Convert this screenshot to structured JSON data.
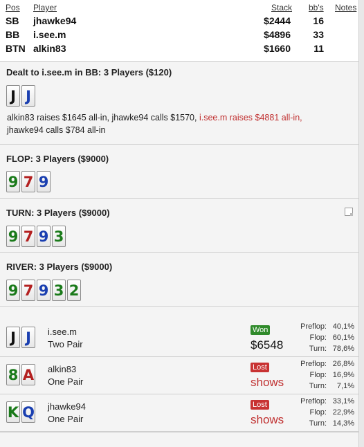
{
  "header": {
    "col_pos": "Pos",
    "col_player": "Player",
    "col_stack": "Stack",
    "col_bbs": "bb's",
    "col_notes": "Notes",
    "players": [
      {
        "pos": "SB",
        "name": "jhawke94",
        "stack": "$2444",
        "bbs": "16"
      },
      {
        "pos": "BB",
        "name": "i.see.m",
        "stack": "$4896",
        "bbs": "33"
      },
      {
        "pos": "BTN",
        "name": "alkin83",
        "stack": "$1660",
        "bbs": "11"
      }
    ]
  },
  "preflop": {
    "title": "Dealt to i.see.m in BB: 3 Players ($120)",
    "cards": [
      {
        "rank": "J",
        "suit": "s"
      },
      {
        "rank": "J",
        "suit": "d"
      }
    ],
    "actions_a": "alkin83 raises $1645 all-in, jhawke94 calls $1570, ",
    "actions_hl": "i.see.m raises $4881 all-in,",
    "actions_b": "jhawke94 calls $784 all-in"
  },
  "flop": {
    "title": "FLOP: 3 Players ($9000)",
    "cards": [
      {
        "rank": "9",
        "suit": "c"
      },
      {
        "rank": "7",
        "suit": "h"
      },
      {
        "rank": "9",
        "suit": "d"
      }
    ]
  },
  "turn": {
    "title": "TURN: 3 Players ($9000)",
    "cards": [
      {
        "rank": "9",
        "suit": "c"
      },
      {
        "rank": "7",
        "suit": "h"
      },
      {
        "rank": "9",
        "suit": "d"
      },
      {
        "rank": "3",
        "suit": "c"
      }
    ],
    "note_icon": "note-icon"
  },
  "river": {
    "title": "RIVER: 3 Players ($9000)",
    "cards": [
      {
        "rank": "9",
        "suit": "c"
      },
      {
        "rank": "7",
        "suit": "h"
      },
      {
        "rank": "9",
        "suit": "d"
      },
      {
        "rank": "3",
        "suit": "c"
      },
      {
        "rank": "2",
        "suit": "c"
      }
    ]
  },
  "results": [
    {
      "name": "i.see.m",
      "hand": "Two Pair",
      "badge": "Won",
      "amount": "$6548",
      "cards": [
        {
          "rank": "J",
          "suit": "s"
        },
        {
          "rank": "J",
          "suit": "d"
        }
      ],
      "eq_labels": [
        "Preflop:",
        "Flop:",
        "Turn:"
      ],
      "eq_values": [
        "40,1%",
        "60,1%",
        "78,6%"
      ]
    },
    {
      "name": "alkin83",
      "hand": "One Pair",
      "badge": "Lost",
      "amount": "shows",
      "cards": [
        {
          "rank": "8",
          "suit": "c"
        },
        {
          "rank": "A",
          "suit": "h"
        }
      ],
      "eq_labels": [
        "Preflop:",
        "Flop:",
        "Turn:"
      ],
      "eq_values": [
        "26,8%",
        "16,9%",
        "7,1%"
      ]
    },
    {
      "name": "jhawke94",
      "hand": "One Pair",
      "badge": "Lost",
      "amount": "shows",
      "cards": [
        {
          "rank": "K",
          "suit": "c"
        },
        {
          "rank": "Q",
          "suit": "d"
        }
      ],
      "eq_labels": [
        "Preflop:",
        "Flop:",
        "Turn:"
      ],
      "eq_values": [
        "33,1%",
        "22,9%",
        "14,3%"
      ]
    }
  ],
  "colors": {
    "won": "#2f8a2a",
    "lost": "#c83232",
    "spade": "#111111",
    "heart": "#b32020",
    "diamond": "#1a3fb0",
    "club": "#1a7a1a"
  }
}
